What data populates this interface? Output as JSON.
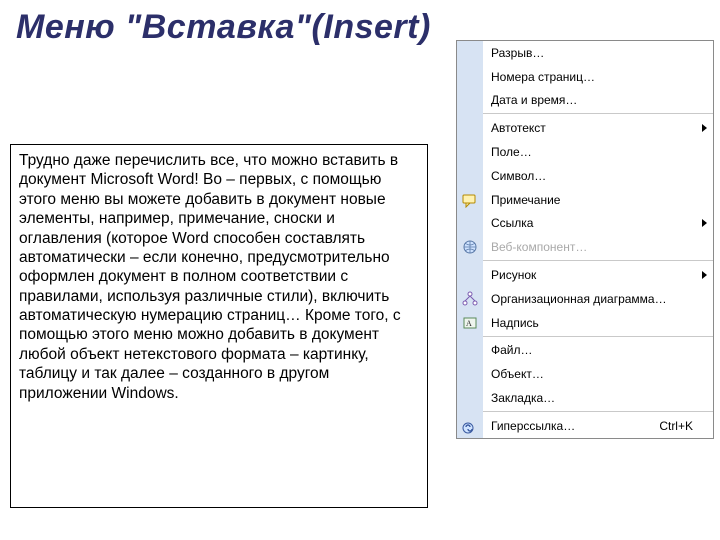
{
  "title": "Меню \"Вставка\"(Insert)",
  "body_text": "Трудно даже перечислить все, что можно вставить в документ Microsoft Word! Во – первых, с помощью этого меню вы можете добавить в документ новые элементы, например, примечание, сноски и оглавления (которое Word способен составлять автоматически – если конечно, предусмотрительно оформлен документ в полном соответствии с правилами, используя различные стили), включить автоматическую нумерацию страниц… Кроме того, с помощью этого меню можно добавить в документ любой объект нетекстового формата – картинку, таблицу и так далее – созданного в другом приложении Windows.",
  "menu": {
    "items": [
      {
        "label": "Разрыв…",
        "submenu": false,
        "icon": null,
        "disabled": false
      },
      {
        "label": "Номера страниц…",
        "submenu": false,
        "icon": null,
        "disabled": false
      },
      {
        "label": "Дата и время…",
        "submenu": false,
        "icon": null,
        "disabled": false
      },
      {
        "label": "Автотекст",
        "submenu": true,
        "icon": null,
        "disabled": false
      },
      {
        "label": "Поле…",
        "submenu": false,
        "icon": null,
        "disabled": false
      },
      {
        "label": "Символ…",
        "submenu": false,
        "icon": null,
        "disabled": false
      },
      {
        "label": "Примечание",
        "submenu": false,
        "icon": "comment",
        "disabled": false
      },
      {
        "label": "Ссылка",
        "submenu": true,
        "icon": null,
        "disabled": false
      },
      {
        "label": "Веб-компонент…",
        "submenu": false,
        "icon": "web",
        "disabled": true
      },
      {
        "label": "Рисунок",
        "submenu": true,
        "icon": null,
        "disabled": false
      },
      {
        "label": "Организационная диаграмма…",
        "submenu": false,
        "icon": "diagram",
        "disabled": false
      },
      {
        "label": "Надпись",
        "submenu": false,
        "icon": "textbox",
        "disabled": false
      },
      {
        "label": "Файл…",
        "submenu": false,
        "icon": null,
        "disabled": false
      },
      {
        "label": "Объект…",
        "submenu": false,
        "icon": null,
        "disabled": false
      },
      {
        "label": "Закладка…",
        "submenu": false,
        "icon": null,
        "disabled": false
      },
      {
        "label": "Гиперссылка…",
        "submenu": false,
        "icon": "hyperlink",
        "disabled": false,
        "shortcut": "Ctrl+K"
      }
    ],
    "separators_after": [
      2,
      8,
      11,
      14
    ]
  }
}
